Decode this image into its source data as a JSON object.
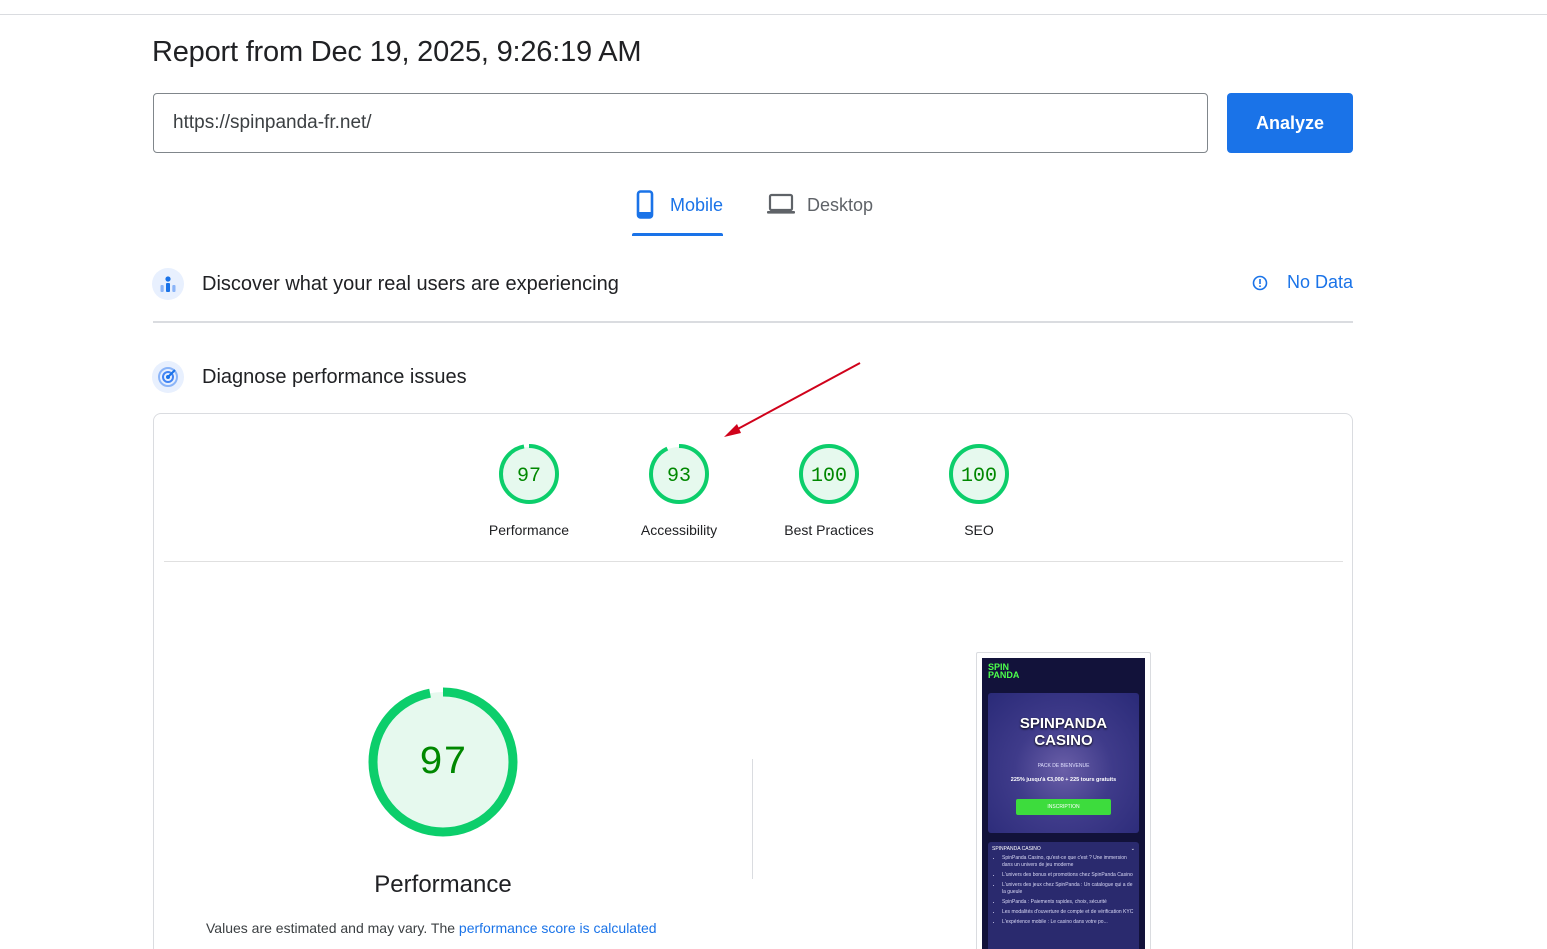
{
  "report": {
    "title": "Report from Dec 19, 2025, 9:26:19 AM"
  },
  "url_input": {
    "value": "https://spinpanda-fr.net/"
  },
  "analyze_button": {
    "label": "Analyze"
  },
  "tabs": [
    {
      "label": "Mobile",
      "active": true,
      "icon": "phone-icon"
    },
    {
      "label": "Desktop",
      "active": false,
      "icon": "laptop-icon"
    }
  ],
  "crux": {
    "title": "Discover what your real users are experiencing",
    "status": "No Data",
    "icon": "users-chart-icon"
  },
  "diagnose": {
    "title": "Diagnose performance issues",
    "icon": "lighthouse-icon"
  },
  "scores": [
    {
      "label": "Performance",
      "value": "97",
      "fraction": 0.97
    },
    {
      "label": "Accessibility",
      "value": "93",
      "fraction": 0.93
    },
    {
      "label": "Best Practices",
      "value": "100",
      "fraction": 1.0
    },
    {
      "label": "SEO",
      "value": "100",
      "fraction": 1.0
    }
  ],
  "performance_detail": {
    "value": "97",
    "fraction": 0.97,
    "title": "Performance",
    "note_prefix": "Values are estimated and may vary. The ",
    "note_link": "performance score is calculated"
  },
  "screenshot": {
    "logo_line1": "SPIN",
    "logo_line2": "PANDA",
    "hero_title_line1": "SPINPANDA",
    "hero_title_line2": "CASINO",
    "hero_subtitle": "PACK DE BIENVENUE",
    "hero_offer": "225% jusqu'à €3,000 + 225 tours gratuits",
    "hero_button": "INSCRIPTION",
    "toc_heading": "SPINPANDA CASINO",
    "toc_items": [
      "SpinPanda Casino, qu'est-ce que c'est ? Une immersion dans un univers de jeu moderne",
      "L'univers des bonus et promotions chez SpinPanda Casino",
      "L'univers des jeux chez SpinPanda : Un catalogue qui a de la gueule",
      "SpinPanda : Paiements rapides, choix, sécurité",
      "Les modalités d'ouverture de compte et de vérification KYC",
      "L'expérience mobile : Le casino dans votre po..."
    ]
  },
  "colors": {
    "accent": "#1a73e8",
    "score_good": "#0cce6b",
    "score_good_text": "#008800",
    "score_good_fill": "#e6f9ee",
    "annotation_arrow": "#d0021b"
  }
}
